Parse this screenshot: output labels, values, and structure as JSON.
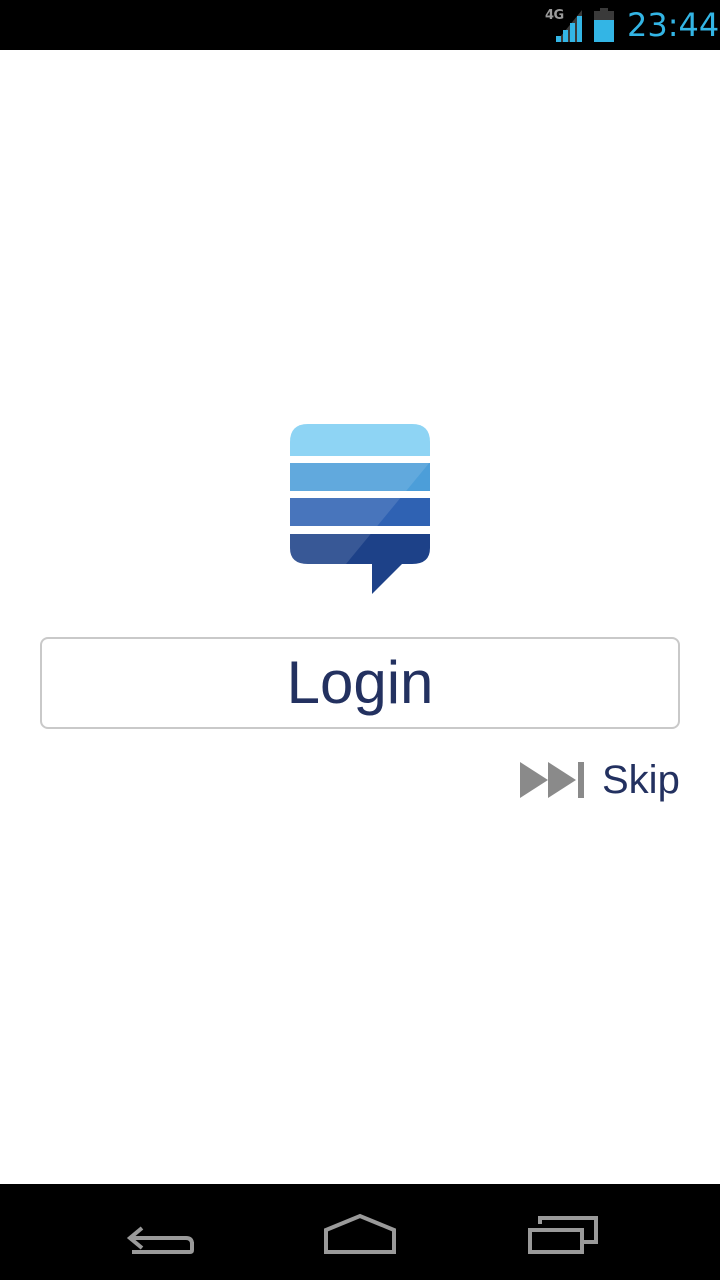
{
  "status_bar": {
    "network_label": "4G",
    "clock": "23:44",
    "clock_color": "#33b5e5",
    "icons": [
      "signal-icon",
      "battery-icon"
    ]
  },
  "app": {
    "logo_icon": "stack-exchange-logo",
    "logo_colors": [
      "#7ecef4",
      "#4a9bd8",
      "#2f61b2",
      "#1c3f86"
    ],
    "login_label": "Login",
    "skip_label": "Skip",
    "text_color": "#233160"
  },
  "nav_bar": {
    "icons": [
      "back-icon",
      "home-icon",
      "recent-apps-icon"
    ]
  }
}
